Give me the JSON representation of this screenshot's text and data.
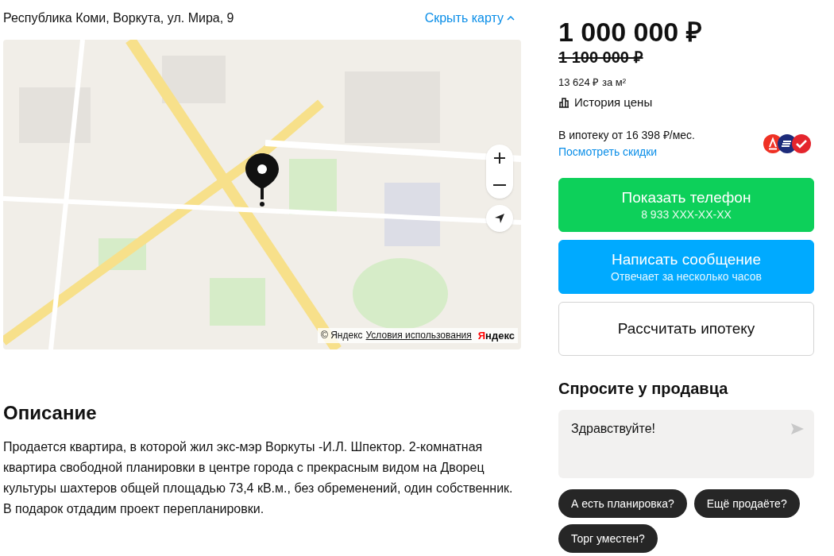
{
  "address": "Республика Коми, Воркута, ул. Мира, 9",
  "map_toggle": "Скрыть карту",
  "map": {
    "kind": "picture",
    "attribution": "© Яндекс",
    "terms_link": "Условия использования",
    "logo": "Яндекс"
  },
  "description": {
    "title": "Описание",
    "text": "Продается квартира, в которой жил экс-мэр Воркуты -И.Л. Шпектор. 2-комнатная квартира свободной планировки в центре города с прекрасным видом на Дворец культуры шахтеров общей площадью 73,4 кВ.м., без обременений, один собственник. В подарок отдадим проект перепланировки."
  },
  "price": {
    "current": "1 000 000 ₽",
    "old": "1 100 000 ₽",
    "per_m2": "13 624 ₽ за м²",
    "history": "История цены"
  },
  "mortgage": {
    "text": "В ипотеку от 16 398 ₽/мес.",
    "link": "Посмотреть скидки",
    "banks": [
      {
        "color": "#ef3124"
      },
      {
        "color": "#1d2b7a"
      },
      {
        "color": "#e4252d"
      }
    ]
  },
  "buttons": [
    {
      "kind": "green",
      "title": "Показать телефон",
      "subtitle": "8 933 XXX-XX-XX"
    },
    {
      "kind": "blue",
      "title": "Написать сообщение",
      "subtitle": "Отвечает за несколько часов"
    },
    {
      "kind": "outline",
      "title": "Рассчитать ипотеку"
    }
  ],
  "ask": {
    "title": "Спросите у продавца",
    "message": "Здравствуйте!",
    "chips": [
      "А есть планировка?",
      "Ещё продаёте?",
      "Торг уместен?"
    ]
  }
}
